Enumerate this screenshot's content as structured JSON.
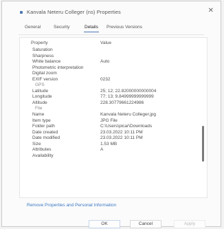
{
  "window": {
    "title": "Kanvala Neteru Colleger (ns) Properties",
    "close_glyph": "✕"
  },
  "tabs": [
    {
      "label": "General",
      "active": false
    },
    {
      "label": "Security",
      "active": false
    },
    {
      "label": "Details",
      "active": true
    },
    {
      "label": "Previous Versions",
      "active": false
    }
  ],
  "details": {
    "headers": {
      "property": "Property",
      "value": "Value"
    },
    "rows": [
      {
        "name": "Saturation",
        "value": ""
      },
      {
        "name": "Sharpness",
        "value": ""
      },
      {
        "name": "White balance",
        "value": "Auto"
      },
      {
        "name": "Photometric interpretation",
        "value": ""
      },
      {
        "name": "Digital zoom",
        "value": ""
      },
      {
        "name": "EXIF version",
        "value": "0232"
      },
      {
        "name": "GPS",
        "value": "",
        "section": true
      },
      {
        "name": "Latitude",
        "value": "25; 12; 22.82000000000004"
      },
      {
        "name": "Longitude",
        "value": "77; 13; 9.84999999999999"
      },
      {
        "name": "Altitude",
        "value": "228.30779661224986"
      },
      {
        "name": "File",
        "value": "",
        "section": true
      },
      {
        "name": "Name",
        "value": "Kanvala Neteru Colleger.jpg"
      },
      {
        "name": "Item type",
        "value": "JPG File"
      },
      {
        "name": "Folder path",
        "value": "C:\\Users\\picar\\Downloads"
      },
      {
        "name": "Date created",
        "value": "23.03.2022 10:11 PM"
      },
      {
        "name": "Date modified",
        "value": "23.03.2022 10:11 PM"
      },
      {
        "name": "Size",
        "value": "1.53 MB"
      },
      {
        "name": "Attributes",
        "value": "A"
      },
      {
        "name": "Availability",
        "value": ""
      }
    ]
  },
  "link": "Remove Properties and Personal Information",
  "buttons": {
    "ok": "OK",
    "cancel": "Cancel",
    "apply": "Apply"
  }
}
